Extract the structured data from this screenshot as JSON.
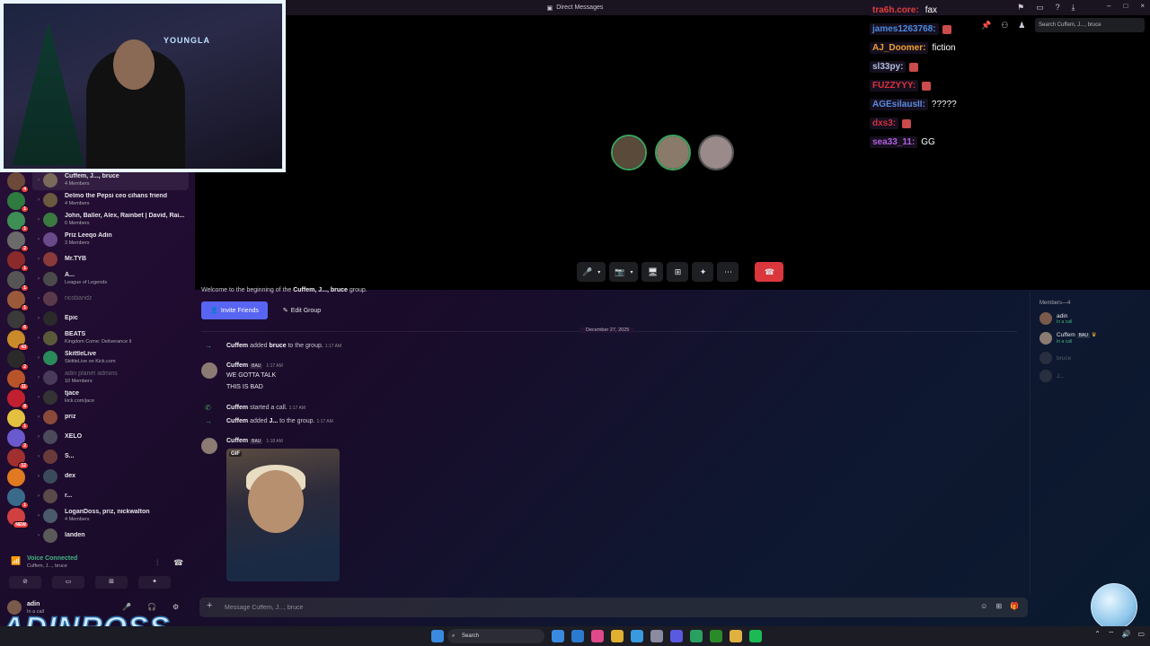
{
  "window": {
    "title": "Direct Messages",
    "controls": [
      "–",
      "□",
      "×"
    ]
  },
  "header": {
    "search_placeholder": "Search Cuffem, J..., bruce"
  },
  "servers": [
    {
      "color": "#6b4a3a",
      "badge": "4"
    },
    {
      "color": "#2f7a3e",
      "badge": "1"
    },
    {
      "color": "#3e8f55",
      "badge": "1"
    },
    {
      "color": "#6a6a6a",
      "badge": "2"
    },
    {
      "color": "#8a2a2a",
      "badge": "1"
    },
    {
      "color": "#555",
      "badge": "1"
    },
    {
      "color": "#9a5a3a",
      "badge": "1"
    },
    {
      "color": "#3a3a3a",
      "badge": "6"
    },
    {
      "color": "#c98a2a",
      "badge": "43"
    },
    {
      "color": "#2a2a2a",
      "badge": "2"
    },
    {
      "color": "#b8542a",
      "badge": "11"
    },
    {
      "color": "#c02030",
      "badge": "8"
    },
    {
      "color": "#e3c040",
      "badge": "1"
    },
    {
      "color": "#6a5acd",
      "badge": "2"
    },
    {
      "color": "#a03030",
      "badge": "12"
    },
    {
      "color": "#e07a20",
      "badge": ""
    },
    {
      "color": "#3a6a8a",
      "badge": "1"
    },
    {
      "color": "#d04040",
      "badge": "NEW"
    }
  ],
  "dms": [
    {
      "name": "Cuffem, J..., bruce",
      "sub": "4 Members",
      "color": "#7a6a5a",
      "active": true,
      "dim": false
    },
    {
      "name": "Delmo the Pepsi ceo cihans friend",
      "sub": "4 Members",
      "color": "#6a5a40",
      "active": false,
      "dim": false
    },
    {
      "name": "John, Baller, Alex, Rainbet | David, Rai...",
      "sub": "6 Members",
      "color": "#3a7a40",
      "active": false,
      "dim": false
    },
    {
      "name": "Priz Leeqo Adin",
      "sub": "3 Members",
      "color": "#6a4a8a",
      "active": false,
      "dim": false
    },
    {
      "name": "Mr.TYB",
      "sub": "",
      "color": "#8a3a3a",
      "active": false,
      "dim": false
    },
    {
      "name": "A...",
      "sub": "League of Legends",
      "color": "#4a4a4a",
      "active": false,
      "dim": false
    },
    {
      "name": "ricobandz",
      "sub": "",
      "color": "#5a3a4a",
      "active": false,
      "dim": true
    },
    {
      "name": "Epic",
      "sub": "",
      "color": "#2a2a2a",
      "active": false,
      "dim": false
    },
    {
      "name": "BEATS",
      "sub": "Kingdom Come: Deliverance II",
      "color": "#5a5a3a",
      "active": false,
      "dim": false
    },
    {
      "name": "SkittleLive",
      "sub": "SkittleLive on Kick.com",
      "color": "#2a8a5a",
      "active": false,
      "dim": false
    },
    {
      "name": "adin planet admins",
      "sub": "10 Members",
      "color": "#4a3a5a",
      "active": false,
      "dim": true
    },
    {
      "name": "tjace",
      "sub": "kick.com/jace",
      "color": "#333",
      "active": false,
      "dim": false
    },
    {
      "name": "priz",
      "sub": "",
      "color": "#8a4a3a",
      "active": false,
      "dim": false
    },
    {
      "name": "XELO",
      "sub": "",
      "color": "#4a4a5a",
      "active": false,
      "dim": false
    },
    {
      "name": "S...",
      "sub": "",
      "color": "#6a3a3a",
      "active": false,
      "dim": false
    },
    {
      "name": "dex",
      "sub": "",
      "color": "#3a4a5a",
      "active": false,
      "dim": false
    },
    {
      "name": "r...",
      "sub": "",
      "color": "#5a4a4a",
      "active": false,
      "dim": false
    },
    {
      "name": "LoganDoss, priz, nickwalton",
      "sub": "4 Members",
      "color": "#4a5a6a",
      "active": false,
      "dim": false
    },
    {
      "name": "landen",
      "sub": "",
      "color": "#5a5a5a",
      "active": false,
      "dim": false
    }
  ],
  "voice": {
    "status": "Voice Connected",
    "channel": "Cuffem, J..., bruce"
  },
  "user": {
    "name": "adin",
    "status": "In a call"
  },
  "branding": {
    "overlay_text": "ADINROSS",
    "cam_logo": "YOUNGLA"
  },
  "call": {
    "participants": [
      {
        "color": "#5a4a3a"
      },
      {
        "color": "#8a7a6a"
      },
      {
        "color": "#9a8a8a"
      }
    ],
    "controls": [
      "🎤",
      "▾",
      "📷",
      "▾",
      "🖥",
      "⊞",
      "✦",
      "⋯"
    ],
    "end_icon": "☎"
  },
  "chat_overlay": [
    {
      "user": "tra6h.core:",
      "msg": "fax",
      "color": "#e0403a",
      "emote": false
    },
    {
      "user": "james1263768:",
      "msg": "",
      "color": "#4a8ae0",
      "emote": true
    },
    {
      "user": "AJ_Doomer:",
      "msg": "fiction",
      "color": "#f0a030",
      "emote": false
    },
    {
      "user": "sl33py:",
      "msg": "",
      "color": "#b0c0e0",
      "emote": true
    },
    {
      "user": "FUZZYYY:",
      "msg": "",
      "color": "#e0303a",
      "emote": true
    },
    {
      "user": "AGEsilausII:",
      "msg": "?????",
      "color": "#5a8ae0",
      "emote": false
    },
    {
      "user": "dxs3:",
      "msg": "",
      "color": "#d03040",
      "emote": true
    },
    {
      "user": "sea33_11:",
      "msg": "GG",
      "color": "#b060e0",
      "emote": false
    }
  ],
  "messages": {
    "welcome_prefix": "Welcome to the beginning of the ",
    "welcome_group": "Cuffem, J..., bruce",
    "welcome_suffix": " group.",
    "invite_label": "Invite Friends",
    "edit_label": "Edit Group",
    "date_divider": "December 27, 2025",
    "system1": {
      "actor": "Cuffem",
      "text": " added ",
      "target": "bruce",
      "tail": " to the group.",
      "time": "1:17 AM"
    },
    "msg1": {
      "author": "Cuffem",
      "tag": "BAU",
      "time": "1:17 AM",
      "lines": [
        "WE GOTTA TALK",
        "THIS IS BAD"
      ]
    },
    "system2": {
      "actor": "Cuffem",
      "text": " started a call.",
      "time": "1:17 AM"
    },
    "system3": {
      "actor": "Cuffem",
      "text": " added ",
      "target": "J...",
      "tail": " to the group.",
      "time": "1:17 AM"
    },
    "msg2": {
      "author": "Cuffem",
      "tag": "BAU",
      "time": "1:18 AM",
      "gif_label": "GIF"
    }
  },
  "composer": {
    "placeholder": "Message Cuffem, J..., bruce"
  },
  "members": {
    "header": "Members—4",
    "list": [
      {
        "name": "adin",
        "status": "In a call",
        "color": "#7a5a4a",
        "offline": false
      },
      {
        "name": "Cuffem",
        "tag": "BAU",
        "status": "In a call",
        "color": "#8b7b72",
        "offline": false
      },
      {
        "name": "bruce",
        "status": "",
        "color": "#666",
        "offline": true
      },
      {
        "name": "J...",
        "status": "",
        "color": "#666",
        "offline": true
      }
    ]
  },
  "taskbar": {
    "search_label": "Search",
    "apps": [
      "#3a8ae0",
      "#2a7ad0",
      "#e04a8a",
      "#e0b030",
      "#3a9ae0",
      "#8a8aa0",
      "#5a5ae0",
      "#2aa060",
      "#2a8a2a",
      "#e0b040",
      "#1db954"
    ]
  }
}
